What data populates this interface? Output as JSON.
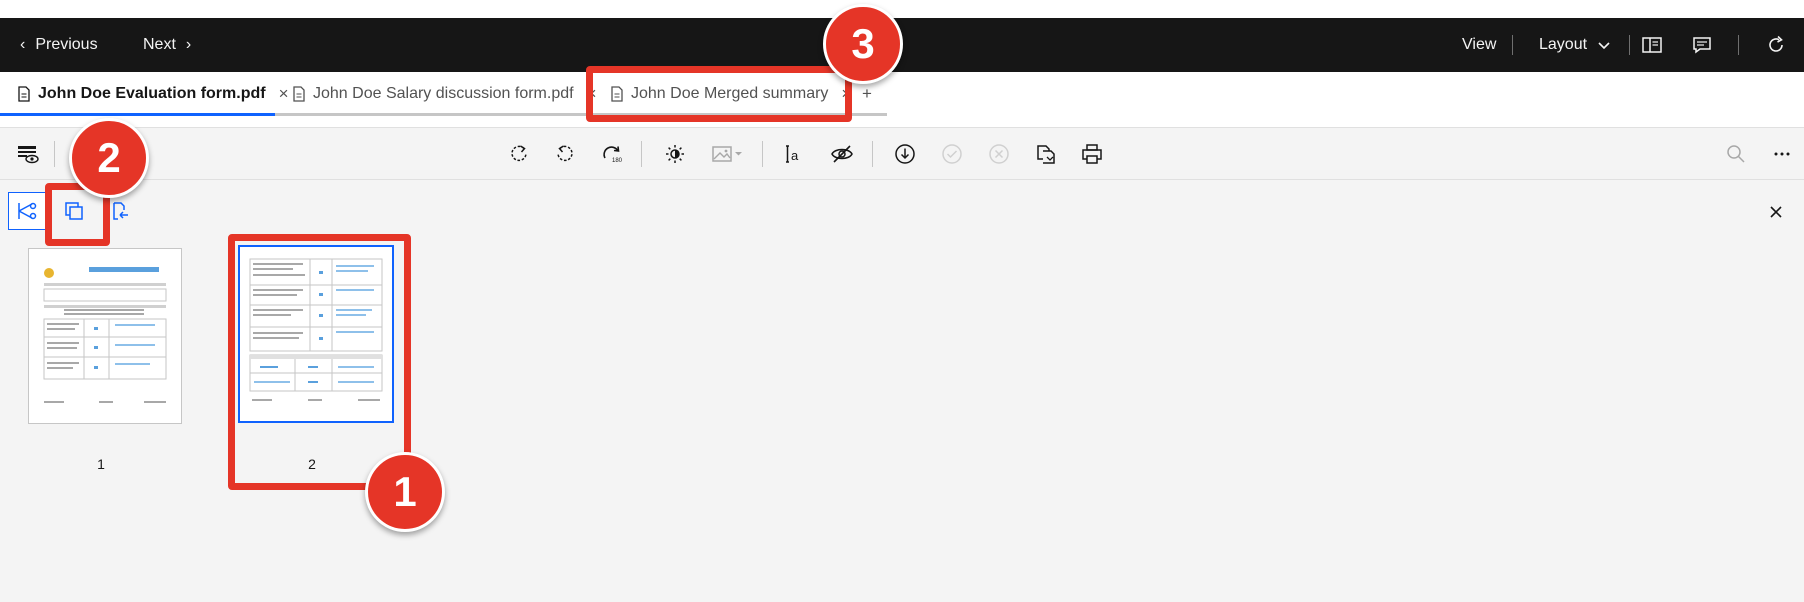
{
  "topbar": {
    "previous_label": "Previous",
    "next_label": "Next",
    "view_label": "View",
    "layout_label": "Layout"
  },
  "tabs": [
    {
      "label": "John Doe Evaluation form.pdf",
      "active": true
    },
    {
      "label": "John Doe Salary discussion form.pdf",
      "active": false
    },
    {
      "label": "John Doe Merged summary",
      "active": false
    }
  ],
  "add_tab_label": "+",
  "close_glyph": "×",
  "thumbnails": [
    {
      "label": "1",
      "selected": false
    },
    {
      "label": "2",
      "selected": true
    }
  ],
  "callouts": [
    "1",
    "2",
    "3"
  ],
  "colors": {
    "topbar_bg": "#161616",
    "accent": "#0f62fe",
    "callout": "#e53527",
    "workspace_bg": "#f4f4f4"
  },
  "icons": {
    "toolbar_left": [
      "view-settings-icon"
    ],
    "toolbar_center": [
      "rotate-clockwise-icon",
      "rotate-counterclockwise-icon",
      "redo-icon",
      "brightness-icon",
      "image-icon",
      "text-select-icon",
      "hide-icon",
      "download-icon",
      "check-circle-icon",
      "cancel-circle-icon",
      "page-extract-icon",
      "print-icon"
    ],
    "toolbar_right": [
      "search-icon",
      "overflow-menu-icon"
    ],
    "mode": [
      "split-icon",
      "copy-icon",
      "page-insert-icon"
    ]
  }
}
